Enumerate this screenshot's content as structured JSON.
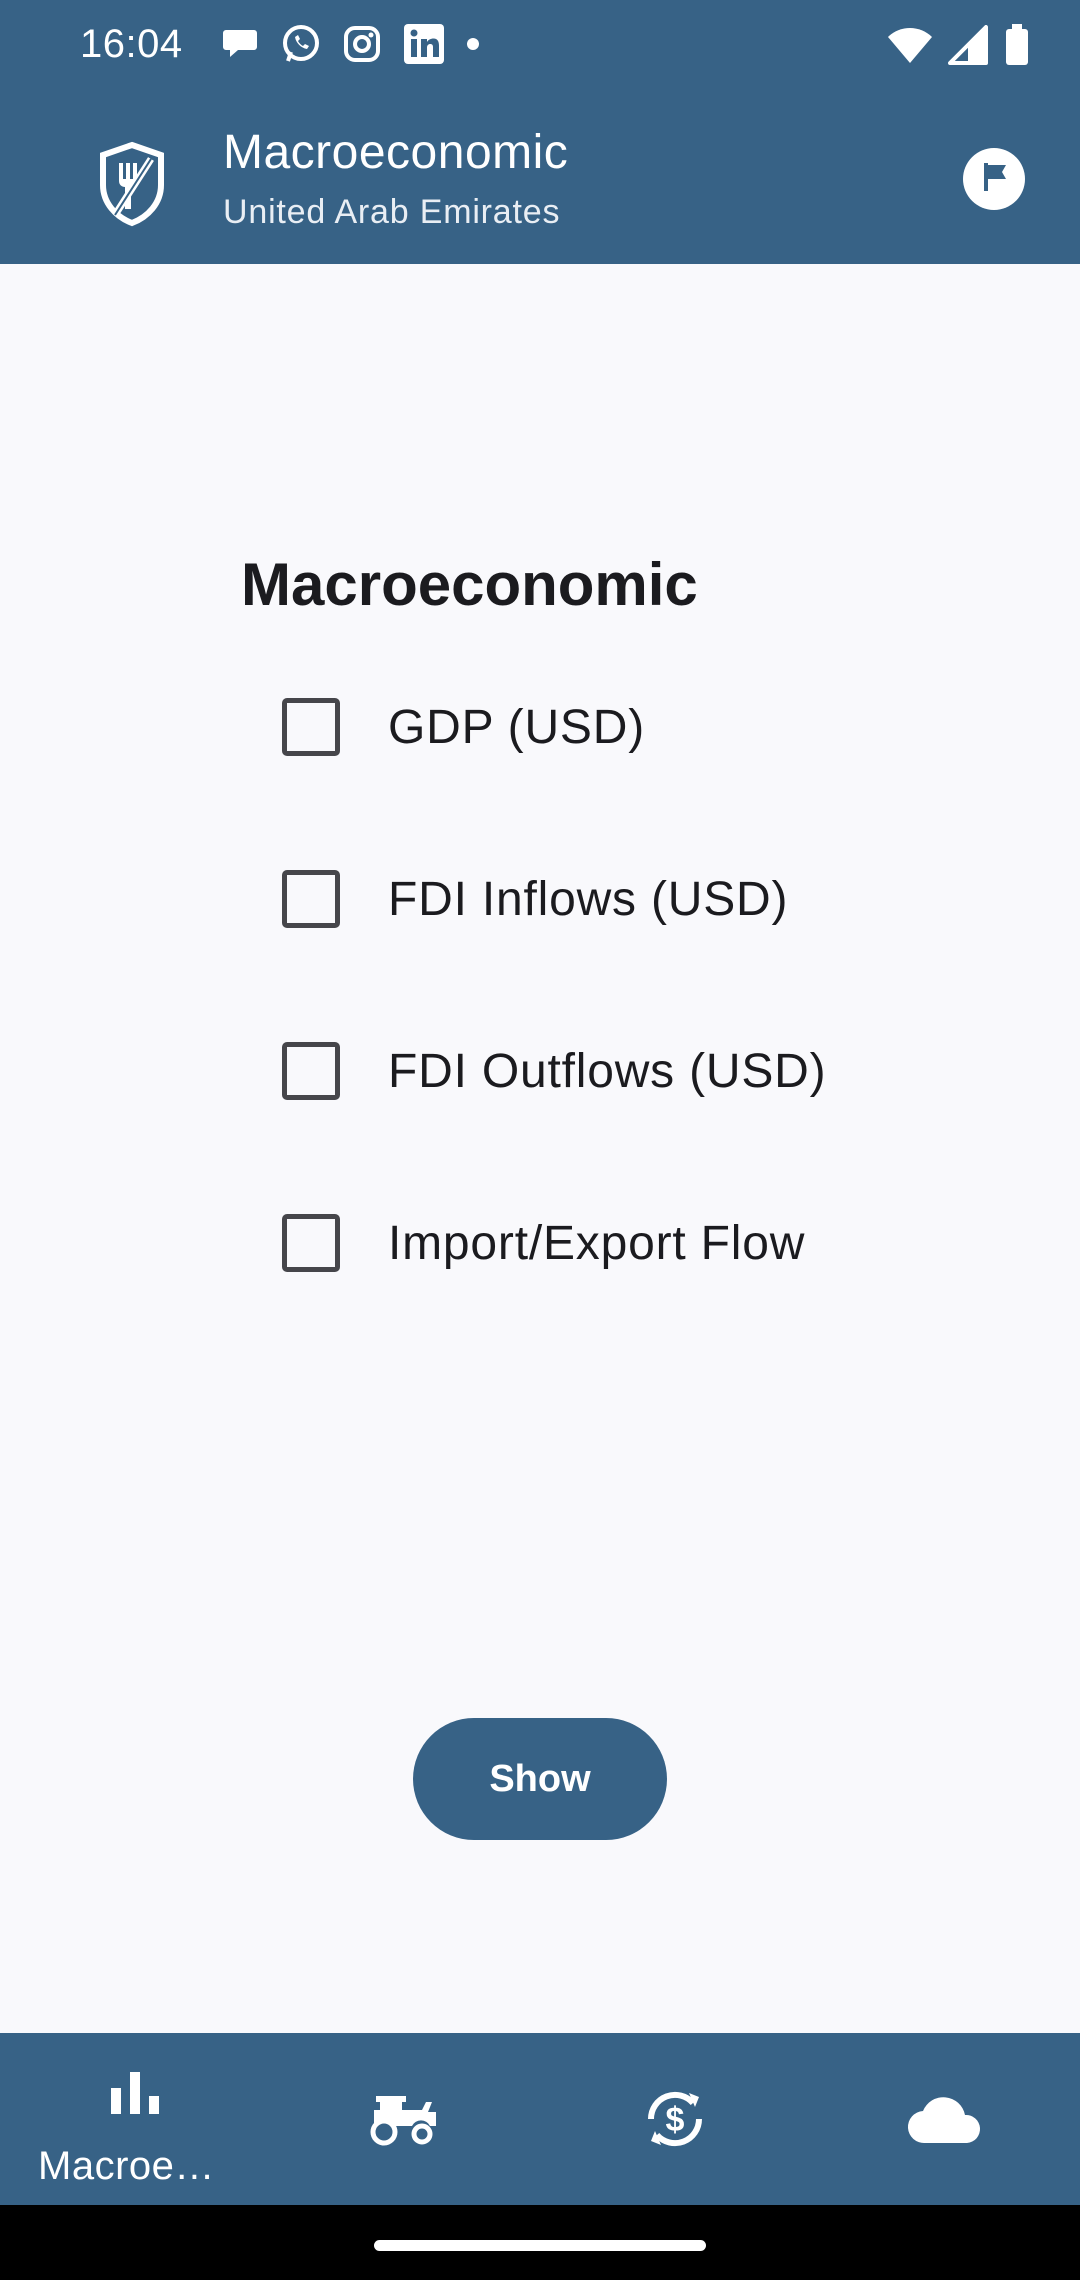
{
  "status_bar": {
    "time": "16:04",
    "notification_icons": [
      "chat-bubble-icon",
      "whatsapp-icon",
      "instagram-icon",
      "linkedin-icon",
      "dot-icon"
    ],
    "system_icons": [
      "wifi-icon",
      "signal-icon",
      "battery-icon"
    ]
  },
  "app_bar": {
    "title": "Macroeconomic",
    "subtitle": "United Arab Emirates",
    "logo_icon": "shield-fork-icon",
    "action_icon": "flag-icon"
  },
  "main": {
    "heading": "Macroeconomic",
    "options": [
      {
        "label": "GDP (USD)",
        "checked": false
      },
      {
        "label": "FDI Inflows (USD)",
        "checked": false
      },
      {
        "label": "FDI Outflows (USD)",
        "checked": false
      },
      {
        "label": "Import/Export Flow",
        "checked": false
      }
    ],
    "show_button": "Show"
  },
  "bottom_nav": {
    "items": [
      {
        "label": "Macroe…",
        "icon": "bar-chart-icon",
        "selected": true
      },
      {
        "label": "",
        "icon": "tractor-icon",
        "selected": false
      },
      {
        "label": "",
        "icon": "currency-exchange-icon",
        "selected": false
      },
      {
        "label": "",
        "icon": "cloud-icon",
        "selected": false
      }
    ]
  },
  "colors": {
    "primary": "#376286",
    "background": "#f9f9fc",
    "text": "#1b1b1f",
    "checkbox_border": "#46464b"
  }
}
